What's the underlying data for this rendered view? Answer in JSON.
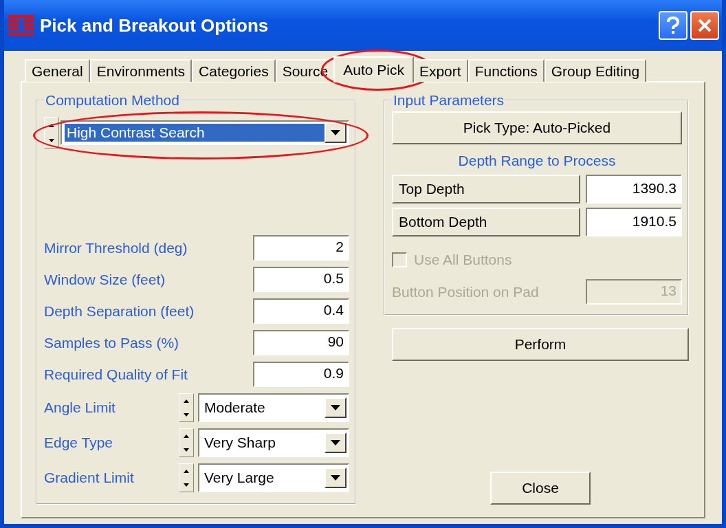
{
  "window": {
    "title": "Pick and Breakout Options"
  },
  "tabs": [
    {
      "label": "General",
      "selected": false,
      "circled": false
    },
    {
      "label": "Environments",
      "selected": false,
      "circled": false
    },
    {
      "label": "Categories",
      "selected": false,
      "circled": false
    },
    {
      "label": "Source",
      "selected": false,
      "circled": false
    },
    {
      "label": "Auto Pick",
      "selected": true,
      "circled": true
    },
    {
      "label": "Export",
      "selected": false,
      "circled": false
    },
    {
      "label": "Functions",
      "selected": false,
      "circled": false
    },
    {
      "label": "Group Editing",
      "selected": false,
      "circled": false
    }
  ],
  "computation_method": {
    "title": "Computation Method",
    "value": "High Contrast Search",
    "focused": true,
    "circled": true
  },
  "parameters": [
    {
      "kind": "text",
      "label": "Mirror Threshold (deg)",
      "value": "2"
    },
    {
      "kind": "text",
      "label": "Window Size (feet)",
      "value": "0.5"
    },
    {
      "kind": "text",
      "label": "Depth Separation (feet)",
      "value": "0.4"
    },
    {
      "kind": "text",
      "label": "Samples to Pass (%)",
      "value": "90"
    },
    {
      "kind": "text",
      "label": "Required Quality of Fit",
      "value": "0.9"
    },
    {
      "kind": "combo",
      "label": "Angle Limit",
      "value": "Moderate"
    },
    {
      "kind": "combo",
      "label": "Edge Type",
      "value": "Very Sharp"
    },
    {
      "kind": "combo",
      "label": "Gradient Limit",
      "value": "Very Large"
    }
  ],
  "input_parameters": {
    "title": "Input Parameters",
    "pick_type_button": "Pick Type:  Auto-Picked",
    "depth_heading": "Depth Range to Process",
    "depths": [
      {
        "label": "Top Depth",
        "value": "1390.3"
      },
      {
        "label": "Bottom Depth",
        "value": "1910.5"
      }
    ],
    "use_all_buttons": {
      "label": "Use All Buttons",
      "checked": false,
      "disabled": true
    },
    "button_position": {
      "label": "Button Position on Pad",
      "value": "13",
      "disabled": true
    }
  },
  "buttons": {
    "perform": "Perform",
    "close": "Close"
  }
}
